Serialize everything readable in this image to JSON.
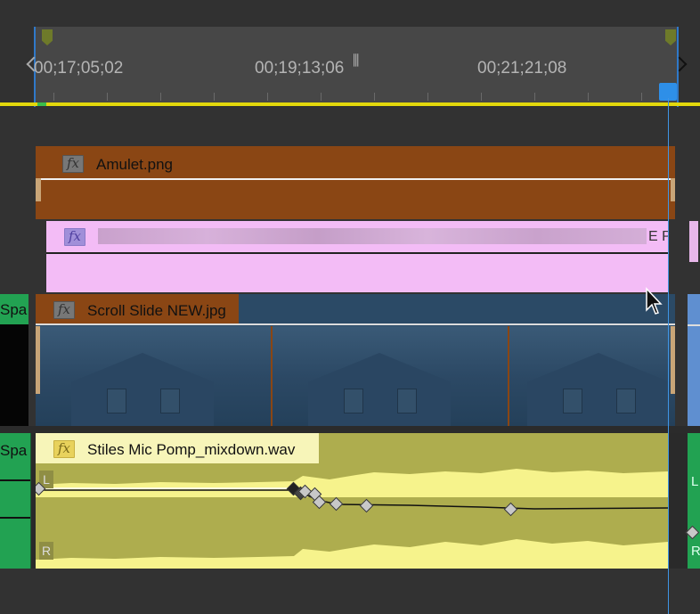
{
  "ruler": {
    "timecodes": [
      "00;17;05;02",
      "00;19;13;06",
      "00;21;21;08"
    ],
    "mid_glyph": "⫼"
  },
  "tracks": {
    "amulet": {
      "clip_name": "Amulet.png",
      "color": "#8a4614"
    },
    "pink": {
      "clip_name_fragment": "E P",
      "color": "#f3bcf6"
    },
    "scroll": {
      "clip_name": "Scroll Slide NEW.jpg",
      "side_label": "Spa"
    },
    "audio": {
      "clip_name": "Stiles Mic Pomp_mixdown.wav",
      "side_label": "Spa",
      "left_label": "L",
      "right_label": "R",
      "right_side_top": "L",
      "right_side_bottom": "R",
      "color": "#aead4e",
      "waveform_color": "#f6f38c"
    }
  },
  "fx_label": "fx",
  "colors": {
    "playhead": "#2e8fe8",
    "work_area": "#e3d80c",
    "in_marker": "#6e7a2a"
  }
}
